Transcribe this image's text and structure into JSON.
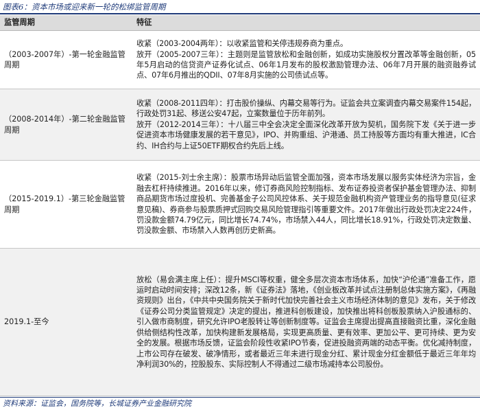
{
  "caption": "图表6：资本市场或迎来新一轮的松绑监管周期",
  "table": {
    "headers": [
      "监管周期",
      "特征"
    ],
    "rows": [
      {
        "period": "（2003-2007年）-第一轮金融监管周期",
        "paragraphs": [
          "收紧（2003-2004两年）：以收紧监管和关停违规券商为重点。",
          "放开（2005-2007三年）：主题则是监管放松和金融创新，如成功实施股权分置改革等金融创新，05年5月启动的信贷资产证券化试点、06年1月发布的股权激励管理办法、06年7月开展的融资融券试点、07年6月推出的QDII、07年8月实施的公司债试点等。"
        ]
      },
      {
        "period": "（2008-2014年）-第二轮金融监管周期",
        "paragraphs": [
          "收紧（2008-2011四年）：打击股价操纵、内幕交易等行为。证监会共立案调查内幕交易案件154起，行政处罚31起、移送公安47起，立案数量位于历年前列。",
          "放开（2012-2014三年）：十八届三中全会决定全面深化改革开放为契机，国务院下发《关于进一步促进资本市场健康发展的若干意见》，IPO、并购重组、沪港通、员工持股等方面均有重大推进，IC合约、IH合约与上证50ETF期权合约先后上线。"
        ]
      },
      {
        "period": "（2015-2019.1）-第三轮金融监管周期",
        "paragraphs": [
          "收紧（2015-刘士余主席）：股票市场异动后监管全面加强，资本市场发展以服务实体经济为宗旨，金融去杠杆持续推进。2016年以来，修订券商风险控制指标、发布证券投资者保护基金管理办法、抑制商品期货市场过度投机、完善基金子公司风控体系、关于规范金融机构资产管理业务的指导意见(征求意见稿)、券商参与股票质押式回购交易风险管理指引等重要文件。2017年做出行政处罚决定224件，罚没款金额74.79亿元，同比增长74.74%，市场禁入44人，同比增长18.91%，行政处罚决定数量、罚没款金额、市场禁入人数再创历史新高。"
        ]
      },
      {
        "period": "2019.1-至今",
        "paragraphs": [
          "放松（易会满主席上任）：提升MSCI等权重，健全多层次资本市场体系，加快“沪伦通”准备工作，愿运时启动时间安排；深改12条，新《证券法》落地，《创业板改革并试点注册制总体实施方案》，《再融资规则》出台，《中共中央国务院关于新时代加快完善社会主义市场经济体制的意见》发布，关于修改《证券公司分类监管规定》决定的提出，推进科创板建设，加快推出将科创板股票纳入沪股通标的、引入做市商制度，研究允许IPO老股转让等创新制度等。证监会主席提出提高直接融资比重，深化金融供给侧结构性改革，加快构建新发展格局，实现更高质量、更有效率、更加公平、更可持续、更为安全的发展。根据市场反馈，证监会阶段性收紧IPO节奏，促进投融资两端的动态平衡。优化减持制度，上市公司存在破发、破净情形，或者最近三年未进行现金分红、累计现金分红金额低于最近三年年均净利润30%的，控股股东、实际控制人不得通过二级市场减持本公司股份。"
        ]
      }
    ]
  },
  "source": "资料来源：证监会，国务院等，长城证券产业金融研究院"
}
